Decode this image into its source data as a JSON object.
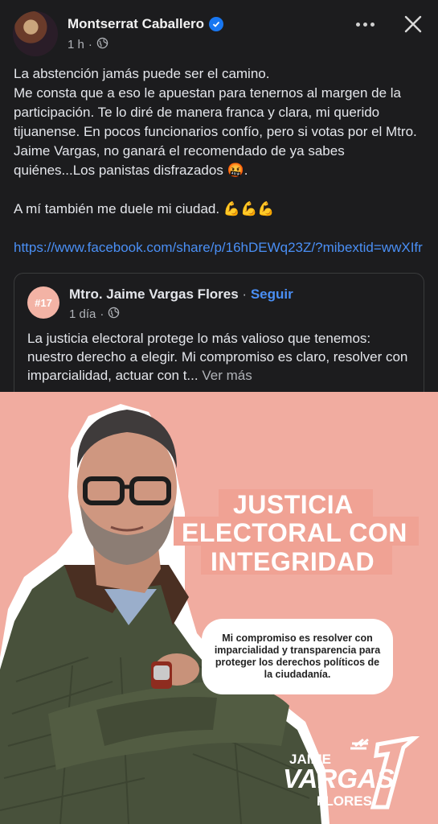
{
  "post": {
    "author": "Montserrat Caballero",
    "time": "1 h",
    "separator": "·",
    "paragraphs": [
      "La abstención jamás puede ser el camino.",
      "Me consta que a eso le apuestan para tenernos al margen de la participación. Te lo diré de manera franca y clara, mi querido tijuanense. En pocos funcionarios confío, pero si votas por el Mtro. Jaime Vargas, no ganará el recomendado de ya sabes quiénes...Los panistas disfrazados 🤬."
    ],
    "line_after": "A mí también me duele mi ciudad. 💪💪💪",
    "link": "https://www.facebook.com/share/p/16hDEWq23Z/?mibextid=wwXIfr"
  },
  "shared": {
    "page_name": "Mtro. Jaime Vargas Flores",
    "dot": " · ",
    "follow_label": "Seguir",
    "time": "1 día",
    "separator": "·",
    "text": "La justicia electoral protege lo más valioso que tenemos: nuestro derecho a elegir. Mi compromiso es claro, resolver con imparcialidad, actuar con t...",
    "see_more": "Ver más",
    "avatar_text": "#17"
  },
  "promo": {
    "headline": [
      "JUSTICIA",
      "ELECTORAL CON",
      "INTEGRIDAD"
    ],
    "quote": "Mi compromiso es resolver con imparcialidad y transparencia para proteger los derechos políticos de la ciudadanía.",
    "logo_top": "JAIME",
    "logo_mid": "VARGAS",
    "logo_bottom": "FLORES",
    "logo_number": "17",
    "logo_hash": "#"
  },
  "colors": {
    "background": "#1c1c1e",
    "link": "#4a8ff5",
    "promo_bg": "#f1aca0",
    "verified": "#1877f2"
  },
  "icons": [
    "globe-icon",
    "verified-badge-icon",
    "more-icon",
    "close-icon"
  ]
}
